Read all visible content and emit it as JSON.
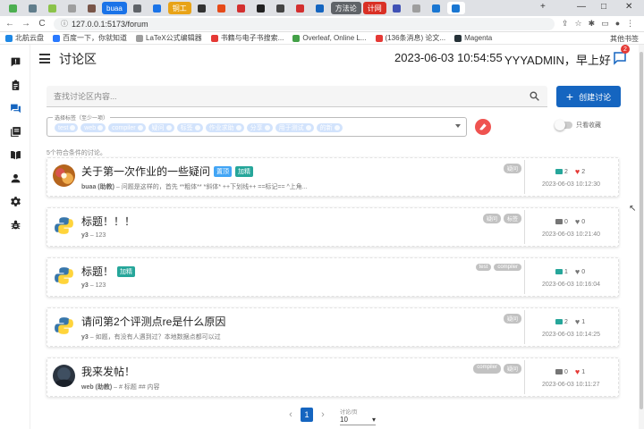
{
  "browser": {
    "tabs": [
      {
        "label": "",
        "style": "plain",
        "color": "#4caf50"
      },
      {
        "label": "",
        "style": "plain",
        "color": "#607d8b"
      },
      {
        "label": "",
        "style": "plain",
        "color": "#8bc34a"
      },
      {
        "label": "",
        "style": "plain",
        "color": "#9e9e9e"
      },
      {
        "label": "",
        "style": "plain",
        "color": "#795548"
      },
      {
        "label": "buaa",
        "style": "blue-pill"
      },
      {
        "label": "",
        "style": "plain",
        "color": "#5f6368"
      },
      {
        "label": "",
        "style": "plain",
        "color": "#1a73e8"
      },
      {
        "label": "铜工",
        "style": "orange-pill"
      },
      {
        "label": "",
        "style": "plain",
        "color": "#333"
      },
      {
        "label": "",
        "style": "plain",
        "color": "#e64a19"
      },
      {
        "label": "",
        "style": "plain",
        "color": "#d32f2f"
      },
      {
        "label": "",
        "style": "plain",
        "color": "#212121"
      },
      {
        "label": "",
        "style": "plain",
        "color": "#444"
      },
      {
        "label": "",
        "style": "plain",
        "color": "#d32f2f"
      },
      {
        "label": "",
        "style": "plain",
        "color": "#1565c0"
      },
      {
        "label": "方法论",
        "style": "gray-pill"
      },
      {
        "label": "计网",
        "style": "red-pill"
      },
      {
        "label": "",
        "style": "plain",
        "color": "#3f51b5"
      },
      {
        "label": "",
        "style": "plain",
        "color": "#9e9e9e"
      },
      {
        "label": "",
        "style": "plain",
        "color": "#1976d2"
      },
      {
        "label": "",
        "style": "active",
        "color": "#1976d2"
      }
    ],
    "new_tab": "+",
    "window_controls": [
      "—",
      "□",
      "✕"
    ],
    "nav": {
      "back": "←",
      "forward": "→",
      "reload": "C"
    },
    "url": "127.0.0.1:5173/forum",
    "bookmarks": [
      {
        "label": "北航云盘",
        "color": "#1e88e5"
      },
      {
        "label": "百度一下，你就知道",
        "color": "#2979ff"
      },
      {
        "label": "LaTeX公式编辑器",
        "color": "#9e9e9e"
      },
      {
        "label": "书籍与电子书搜索...",
        "color": "#e53935"
      },
      {
        "label": "Overleaf, Online L...",
        "color": "#43a047"
      },
      {
        "label": "(136条消息) 论文...",
        "color": "#e53935"
      },
      {
        "label": "Magenta",
        "color": "#263238"
      }
    ],
    "bookmarks_right": "其他书签"
  },
  "sidebar": {
    "icons": [
      "chat-alert-icon",
      "clipboard-icon",
      "forum-icon",
      "stack-icon",
      "book-icon",
      "person-icon",
      "gear-icon",
      "bug-icon"
    ],
    "active_color": "#1565c0"
  },
  "header": {
    "title": "讨论区",
    "datetime": "2023-06-03 10:54:55",
    "greeting": "YYYADMIN，早上好",
    "message_badge": "2"
  },
  "search": {
    "placeholder": "查找讨论区内容...",
    "create_label": "创建讨论"
  },
  "filter": {
    "label": "选择标签（至少一项）",
    "chips": [
      "test",
      "web",
      "compiler",
      "疑问",
      "标签",
      "作业求助",
      "分享",
      "用于测试",
      "的新"
    ],
    "only_favorites": "只看收藏"
  },
  "result_count": "5个符合条件的讨论。",
  "posts": [
    {
      "title": "关于第一次作业的一些疑问",
      "tags": [
        {
          "text": "置顶",
          "color": "#42a5f5"
        },
        {
          "text": "加精",
          "color": "#26a69a"
        }
      ],
      "author": "buaa (助教)",
      "preview": "问题是这样的，首先 **粗体** *斜体* ++下划线++ ==标记== ^上角...",
      "labels": [
        "疑问"
      ],
      "stat1": "2",
      "stat2": "2",
      "stat1_color": "#26a69a",
      "stat2_color": "#e53935",
      "time": "2023-06-03 10:12:30",
      "avatar": "art"
    },
    {
      "title": "标题！！！",
      "tags": [],
      "author": "y3",
      "preview": "123",
      "labels": [
        "疑问",
        "标签"
      ],
      "stat1": "0",
      "stat2": "0",
      "stat1_color": "#757575",
      "stat2_color": "#757575",
      "time": "2023-06-03 10:21:40",
      "avatar": "python"
    },
    {
      "title": "标题！",
      "tags": [
        {
          "text": "加精",
          "color": "#26a69a"
        }
      ],
      "author": "y3",
      "preview": "123",
      "labels": [
        "test",
        "compiler"
      ],
      "stat1": "1",
      "stat2": "0",
      "stat1_color": "#26a69a",
      "stat2_color": "#757575",
      "time": "2023-06-03 10:16:04",
      "avatar": "python"
    },
    {
      "title": "请问第2个评测点re是什么原因",
      "tags": [],
      "author": "y3",
      "preview": "如题，有没有人遇到过？本地数据点都可以过",
      "labels": [
        "疑问"
      ],
      "stat1": "2",
      "stat2": "1",
      "stat1_color": "#26a69a",
      "stat2_color": "#757575",
      "time": "2023-06-03 10:14:25",
      "avatar": "python"
    },
    {
      "title": "我来发帖！",
      "tags": [],
      "author": "web (助教)",
      "preview": "# 标题 ## 内容",
      "labels": [
        "compiler",
        "疑问"
      ],
      "stat1": "0",
      "stat2": "1",
      "stat1_color": "#757575",
      "stat2_color": "#e53935",
      "time": "2023-06-03 10:11:27",
      "avatar": "dark"
    }
  ],
  "pagination": {
    "prev": "‹",
    "current": "1",
    "next": "›",
    "per_page_label": "讨论/页",
    "per_page_value": "10"
  }
}
